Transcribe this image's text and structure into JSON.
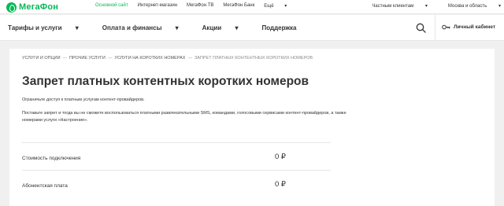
{
  "brand": {
    "name": "МегаФон",
    "color": "#00b956"
  },
  "top_links": [
    {
      "label": "Основной сайт",
      "active": true
    },
    {
      "label": "Интернет-магазин"
    },
    {
      "label": "МегаФон ТВ"
    },
    {
      "label": "МегаФон Банк"
    },
    {
      "label": "Ещё"
    }
  ],
  "top_right": {
    "audience": "Частным клиентам",
    "region": "Москва и область"
  },
  "nav": {
    "items": [
      "Тарифы и услуги",
      "Оплата и финансы",
      "Акции",
      "Поддержка"
    ],
    "cabinet_label": "Личный кабинет"
  },
  "breadcrumb": [
    "Услуги и опции",
    "Прочие услуги",
    "Услуги на коротких номерах",
    "Запрет платных контентных коротких номеров"
  ],
  "page": {
    "title": "Запрет платных контентных коротких номеров",
    "description_1": "Ограничьте доступ к платным услугам контент-провайдеров.",
    "description_2": "Поставьте запрет и тогда вы не сможете воспользоваться платными развлекательными SMS, командами, голосовыми сервисами контент-провайдеров, а также номерами услуги «Настроение»."
  },
  "prices": [
    {
      "label": "Стоимость подключения",
      "value": "0 ₽"
    },
    {
      "label": "Абонентская плата",
      "value": "0 ₽"
    }
  ]
}
